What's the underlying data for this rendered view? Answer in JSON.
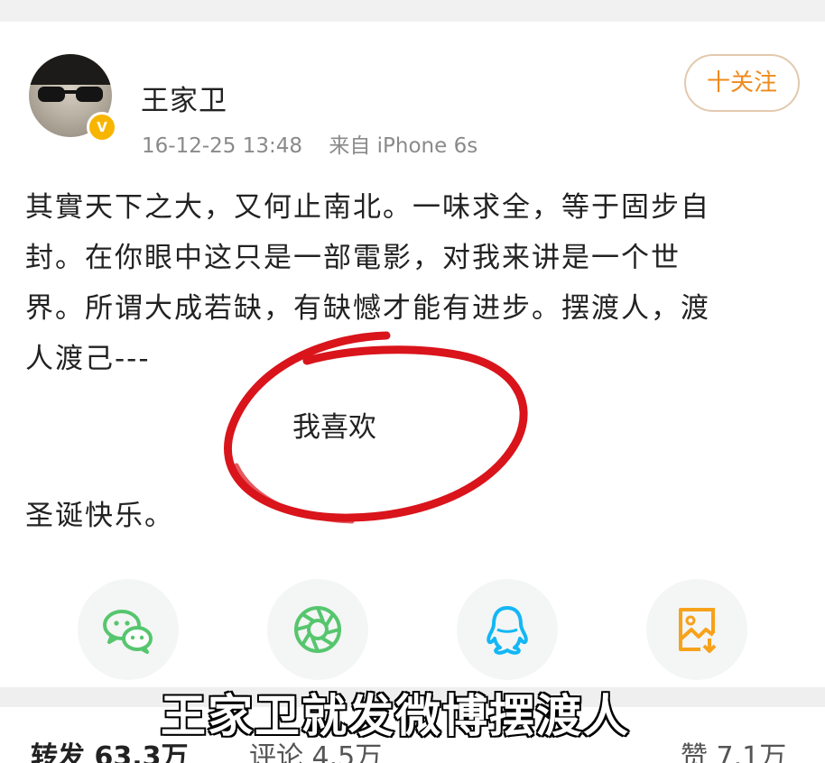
{
  "post": {
    "author": {
      "name": "王家卫",
      "verified_badge": "V"
    },
    "timestamp": "16-12-25 13:48",
    "source": "来自 iPhone 6s",
    "follow_label": "十关注",
    "text_lines": [
      "其實天下之大，又何止南北。一味求全，等于固步自",
      "封。在你眼中这只是一部電影，对我来讲是一个世",
      "界。所谓大成若缺，有缺憾才能有进步。摆渡人，渡",
      "人渡己---"
    ],
    "annotation": "我喜欢",
    "greeting": "圣诞快乐。"
  },
  "share": {
    "items": [
      {
        "icon": "wechat-icon",
        "color": "#56c66e"
      },
      {
        "icon": "moments-icon",
        "color": "#56c66e"
      },
      {
        "icon": "qq-icon",
        "color": "#12b7f5"
      },
      {
        "icon": "save-image-icon",
        "color": "#f7a21b"
      }
    ]
  },
  "stats": {
    "repost": "转发 63.3万",
    "comment": "评论 4.5万",
    "like": "赞 7.1万"
  },
  "caption": "王家卫就发微博摆渡人",
  "colors": {
    "follow": "#f08a1c",
    "annotation_circle": "#d9141b",
    "badge": "#f7b500"
  }
}
